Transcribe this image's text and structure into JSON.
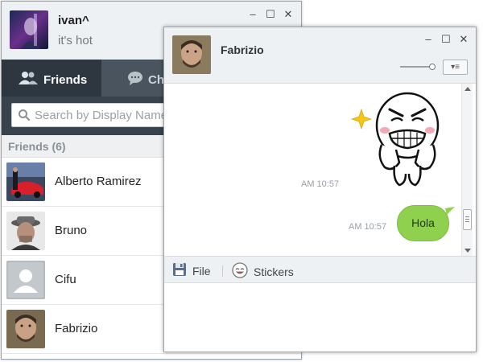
{
  "main_window": {
    "profile": {
      "name": "ivan^",
      "status": "it's hot"
    },
    "controls": {
      "minimize": "–",
      "maximize": "☐",
      "close": "✕"
    },
    "tabs": [
      {
        "label": "Friends",
        "icon": "people-icon",
        "active": true
      },
      {
        "label": "Cha",
        "icon": "chat-bubble-icon",
        "active": false
      }
    ],
    "search": {
      "placeholder": "Search by Display Name"
    },
    "friends_header": "Friends (6)",
    "friends": [
      {
        "name": "Alberto Ramirez"
      },
      {
        "name": "Bruno"
      },
      {
        "name": "Cifu"
      },
      {
        "name": "Fabrizio"
      }
    ]
  },
  "chat_window": {
    "contact_name": "Fabrizio",
    "controls": {
      "minimize": "–",
      "maximize": "☐",
      "close": "✕"
    },
    "menu_button": "▾≡",
    "messages": [
      {
        "type": "sticker",
        "time": "AM 10:57"
      },
      {
        "type": "text",
        "text": "Hola",
        "time": "AM 10:57"
      }
    ],
    "toolbar": {
      "file_label": "File",
      "stickers_label": "Stickers"
    }
  },
  "colors": {
    "tab_bar": "#39434d",
    "active_tab": "#2e3740",
    "bubble": "#8fd14f",
    "header_bg": "#eef1f4"
  }
}
